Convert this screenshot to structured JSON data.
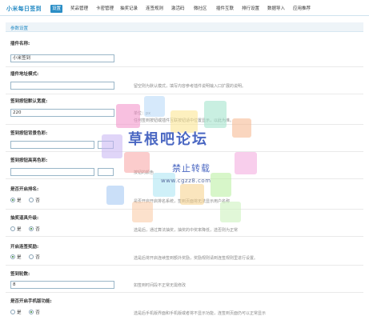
{
  "header": {
    "brand": "小米每日签到",
    "tabs": [
      {
        "label": "设置",
        "active": true
      },
      {
        "label": "奖品管理",
        "active": false
      },
      {
        "label": "卡密管理",
        "active": false
      },
      {
        "label": "抽奖记录",
        "active": false
      },
      {
        "label": "连签规则",
        "active": false
      },
      {
        "label": "激活码",
        "active": false
      },
      {
        "label": "微社区",
        "active": false
      },
      {
        "label": "插件互联",
        "active": false
      },
      {
        "label": "排行设置",
        "active": false
      },
      {
        "label": "数据导入",
        "active": false
      },
      {
        "label": "应用推荐",
        "active": false
      }
    ]
  },
  "section": {
    "title": "参数设置"
  },
  "fields": {
    "plugin_name": {
      "label": "插件名称:",
      "value": "小米签到"
    },
    "plugin_url_mode": {
      "label": "插件地址模式:",
      "value": "",
      "hint": "留空则为默认模式，填写内容参考插件说明输入口扩展的说明。"
    },
    "button_width": {
      "label": "签到按钮默认宽度:",
      "value": "220",
      "hint_unit": "单位：px",
      "hint": "任何签到按钮或插件互联按钮适中位置显示，以此为准。"
    },
    "button_bg_color": {
      "label": "签到按钮背景色彩:",
      "value": ""
    },
    "button_hl_color": {
      "label": "签到按钮高亮色彩:",
      "value": "",
      "hint": "按钮的颜色"
    },
    "show_rank": {
      "label": "是否开启排名:",
      "options": [
        "是",
        "否"
      ],
      "selected": "是",
      "hint": "是否开启开启排名系统，签到页面将无法显示用户名称"
    },
    "lottery": {
      "label": "抽奖道具升级:",
      "options": [
        "是",
        "否"
      ],
      "selected": "否",
      "hint": "选是后，通过算法抽奖，抽奖的中奖率降低，选否则为正常"
    },
    "continuous_reward": {
      "label": "开启连签奖励:",
      "options": [
        "是",
        "否"
      ],
      "selected": "是",
      "hint": "选是后将开启连续签到额外奖励，奖励规则请到连签规则里进行设置。"
    },
    "sign_days": {
      "label": "签到轮数:",
      "value": "8",
      "hint": "如签到时间段不正常无需修改"
    },
    "mobile_sign": {
      "label": "是否开启手机版功能:",
      "options": [
        "是",
        "否"
      ],
      "selected": "否",
      "hint": "选是后手机版界面和手机版或者将不显示功能，连签到页面仍可以正常显示"
    }
  },
  "watermark": {
    "title": "草根吧论坛",
    "subtitle": "禁止转载",
    "url": "www.cgzz8.com"
  },
  "colors": {
    "accent": "#2b8ec6",
    "watermark_text": "#4a67c2"
  }
}
